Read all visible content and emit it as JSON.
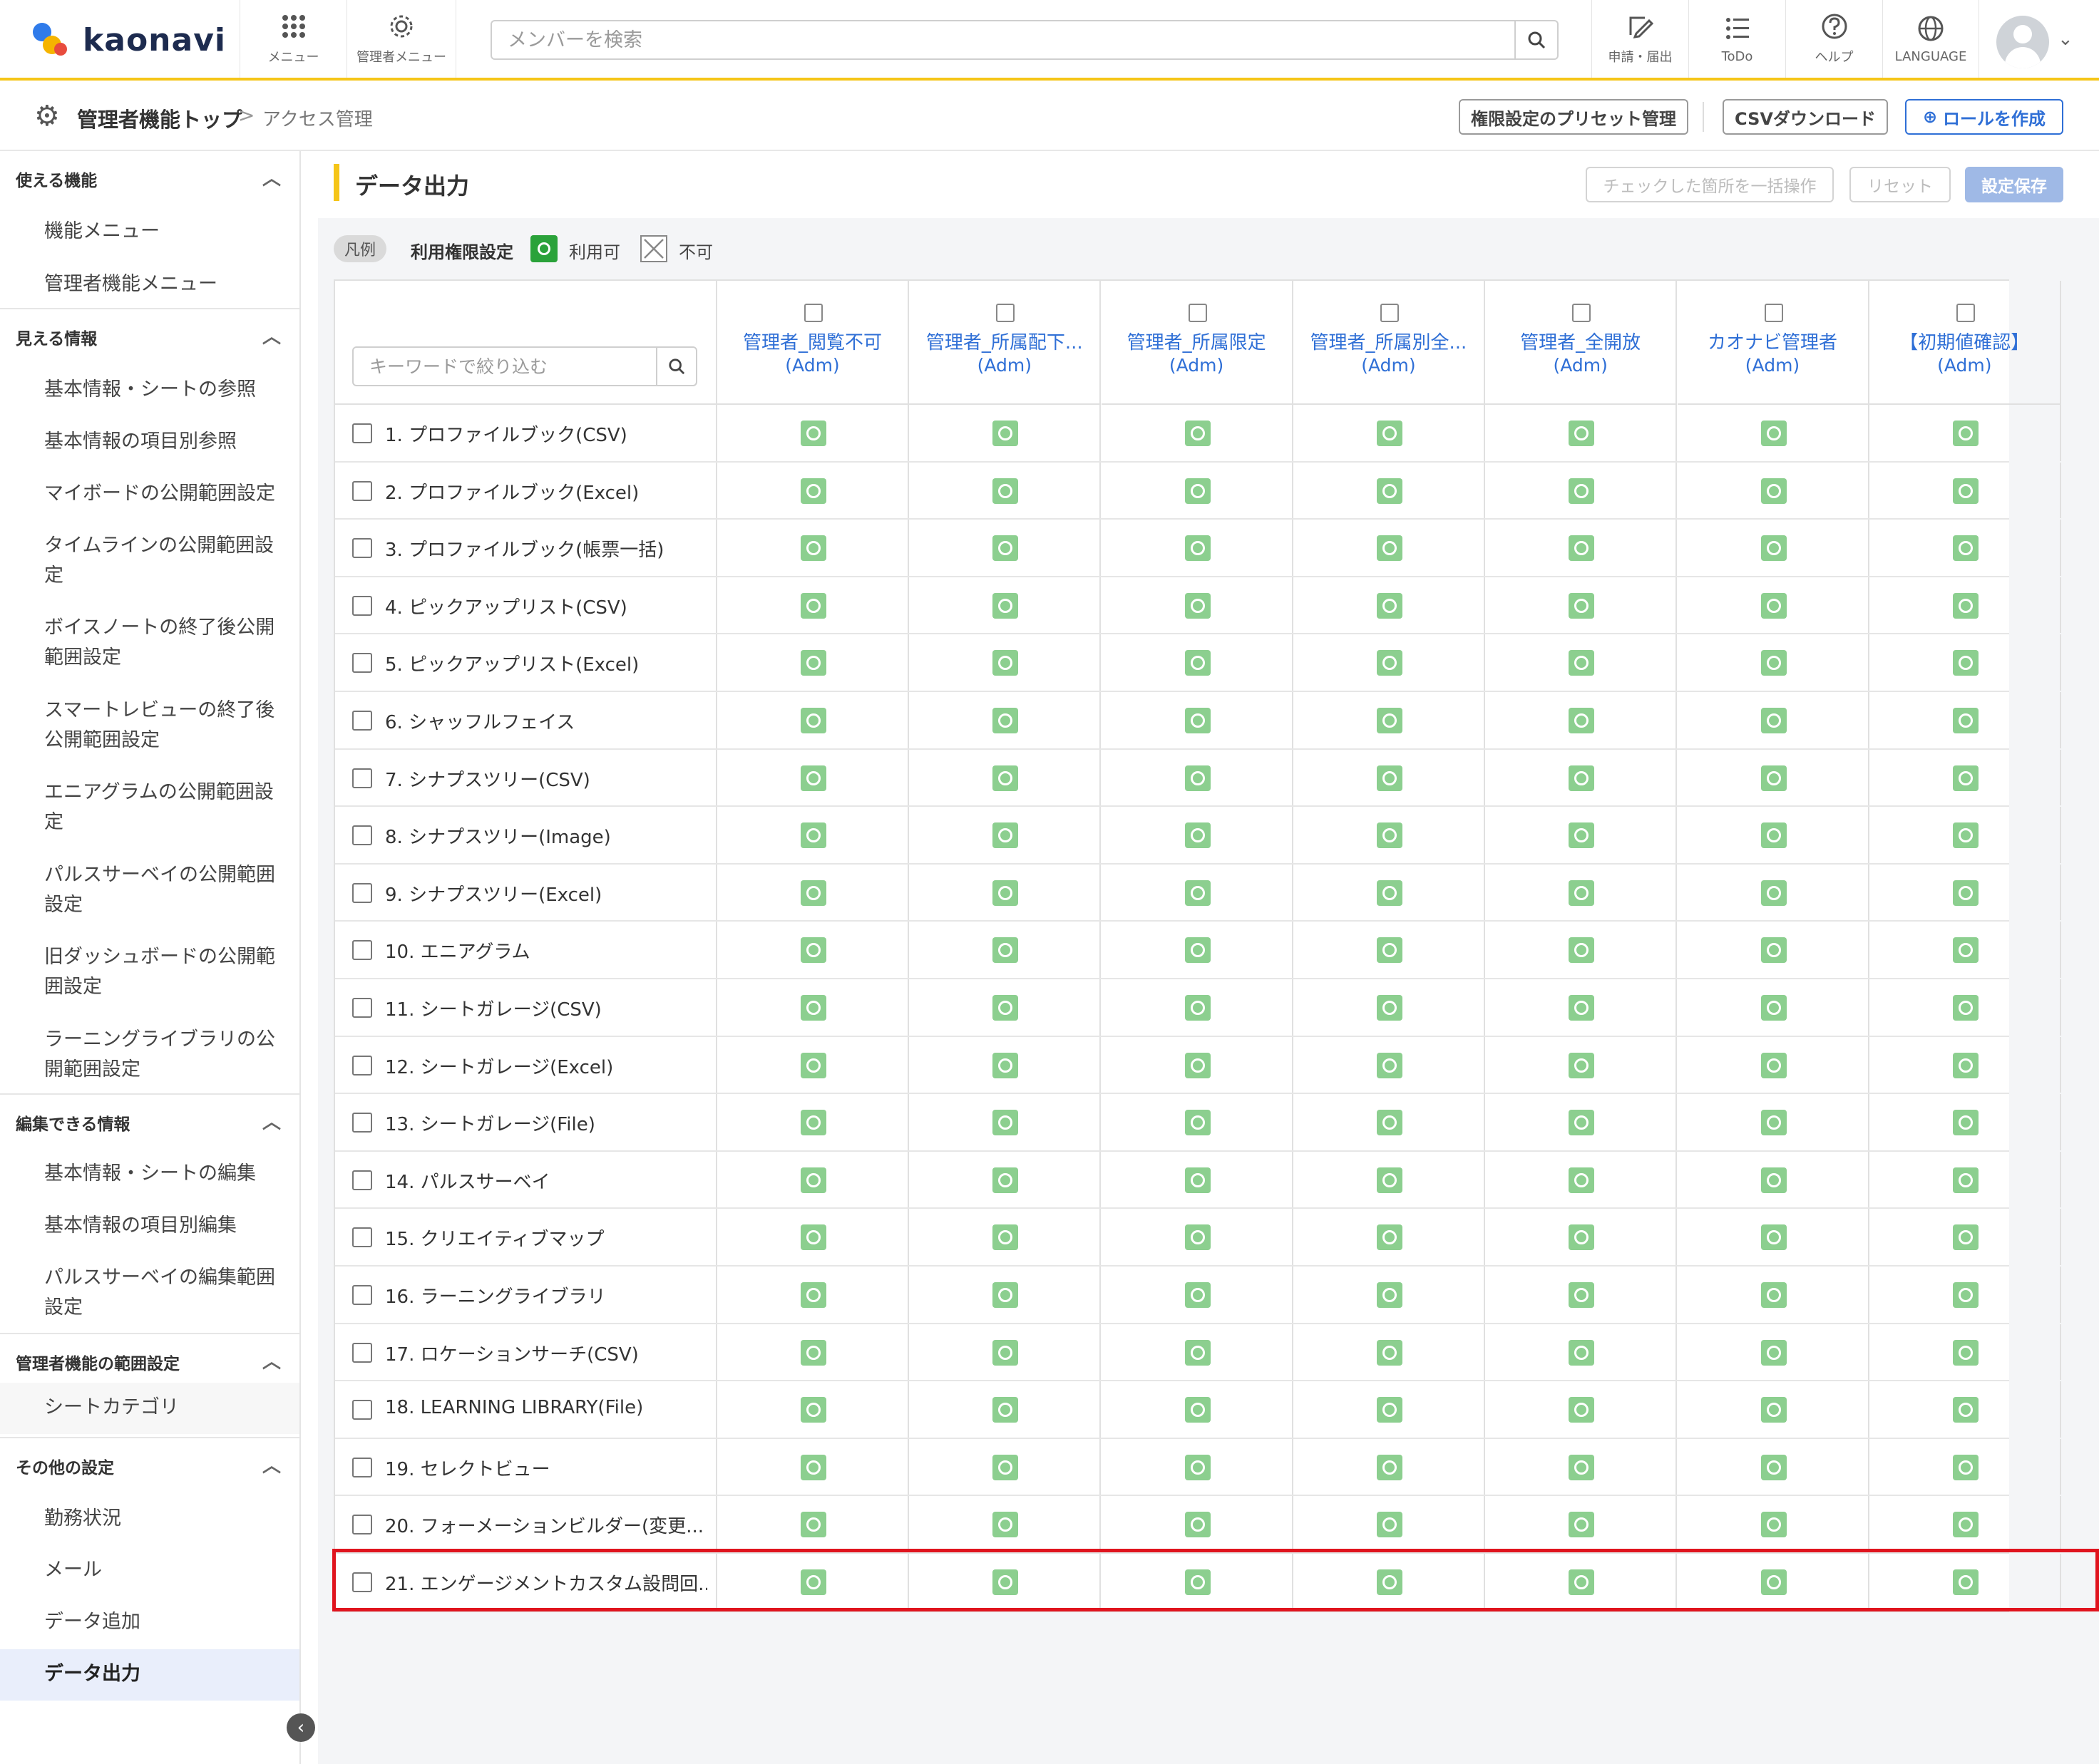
{
  "header": {
    "logo_text": "kaonavi",
    "menu_label": "メニュー",
    "admin_menu_label": "管理者メニュー",
    "search_placeholder": "メンバーを検索",
    "apply_label": "申請・届出",
    "todo_label": "ToDo",
    "help_label": "ヘルプ",
    "language_label": "LANGUAGE"
  },
  "breadcrumb": {
    "top": "管理者機能トップ",
    "separator": ">",
    "current": "アクセス管理"
  },
  "toolbar": {
    "preset_label": "権限設定のプリセット管理",
    "csv_label": "CSVダウンロード",
    "create_role_label": "ロールを作成",
    "create_role_icon": "⊕"
  },
  "sidebar": {
    "sections": [
      {
        "title": "使える機能",
        "items": [
          "機能メニュー",
          "管理者機能メニュー"
        ]
      },
      {
        "title": "見える情報",
        "items": [
          "基本情報・シートの参照",
          "基本情報の項目別参照",
          "マイボードの公開範囲設定",
          "タイムラインの公開範囲設定",
          "ボイスノートの終了後公開範囲設定",
          "スマートレビューの終了後公開範囲設定",
          "エニアグラムの公開範囲設定",
          "パルスサーベイの公開範囲設定",
          "旧ダッシュボードの公開範囲設定",
          "ラーニングライブラリの公開範囲設定"
        ]
      },
      {
        "title": "編集できる情報",
        "items": [
          "基本情報・シートの編集",
          "基本情報の項目別編集",
          "パルスサーベイの編集範囲設定"
        ]
      },
      {
        "title": "管理者機能の範囲設定",
        "items": [
          "シートカテゴリ"
        ]
      },
      {
        "title": "その他の設定",
        "items": [
          "勤務状況",
          "メール",
          "データ追加",
          "データ出力"
        ]
      }
    ],
    "active_item": "データ出力"
  },
  "main": {
    "title": "データ出力",
    "bulk_label": "チェックした箇所を一括操作",
    "reset_label": "リセット",
    "save_label": "設定保存",
    "legend": {
      "pill": "凡例",
      "label": "利用権限設定",
      "ok": "利用可",
      "ng": "不可"
    },
    "keyword_placeholder": "キーワードで絞り込む",
    "columns": [
      {
        "name": "管理者_閲覧不可",
        "sub": "(Adm)"
      },
      {
        "name": "管理者_所属配下...",
        "sub": "(Adm)"
      },
      {
        "name": "管理者_所属限定",
        "sub": "(Adm)"
      },
      {
        "name": "管理者_所属別全...",
        "sub": "(Adm)"
      },
      {
        "name": "管理者_全開放",
        "sub": "(Adm)"
      },
      {
        "name": "カオナビ管理者",
        "sub": "(Adm)"
      },
      {
        "name": "【初期値確認】",
        "sub": "(Adm)"
      }
    ],
    "rows": [
      "1. プロファイルブック(CSV)",
      "2. プロファイルブック(Excel)",
      "3. プロファイルブック(帳票一括)",
      "4. ピックアップリスト(CSV)",
      "5. ピックアップリスト(Excel)",
      "6. シャッフルフェイス",
      "7. シナプスツリー(CSV)",
      "8. シナプスツリー(Image)",
      "9. シナプスツリー(Excel)",
      "10. エニアグラム",
      "11. シートガレージ(CSV)",
      "12. シートガレージ(Excel)",
      "13. シートガレージ(File)",
      "14. パルスサーベイ",
      "15. クリエイティブマップ",
      "16. ラーニングライブラリ",
      "17. ロケーションサーチ(CSV)",
      "18. LEARNING LIBRARY(File)",
      "19. セレクトビュー",
      "20. フォーメーションビルダー(変更...",
      "21. エンゲージメントカスタム設問回..."
    ],
    "highlighted_row": "21. エンゲージメントカスタム設問回..."
  },
  "colors": {
    "accent_yellow": "#f5c518",
    "link_blue": "#2f6fd6",
    "ok_green": "#8ccf8f",
    "legend_green": "#2aa23a",
    "highlight_red": "#e0141e"
  }
}
